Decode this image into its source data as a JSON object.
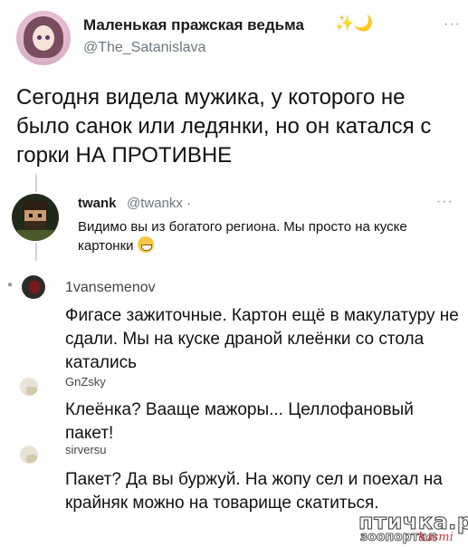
{
  "tweet": {
    "author_name": "Маленькая пражская ведьма",
    "author_emoji": "✨🌙",
    "author_handle": "@The_Satanislava",
    "more": "···",
    "text": "Сегодня видела мужика, у которого не было санок или ледянки, но он катался с горки НА ПРОТИВНЕ"
  },
  "reply": {
    "name": "twank",
    "handle": "@twankx ·",
    "more": "···",
    "text": "Видимо вы из богатого региона. Мы просто на куске картонки"
  },
  "comments": [
    {
      "name": "1vansemenov",
      "text": "Фигасе зажиточные. Картон ещё в макулатуру не сдали. Мы на куске драной клеёнки со стола катались"
    },
    {
      "name": "GnZsky",
      "text": "Клеёнка? Вааще мажоры...  Целлофановый пакет!"
    },
    {
      "name": "sirversu",
      "text": "Пакет? Да вы буржуй. На жопу сел и поехал на крайняк можно на товарище скатиться."
    }
  ],
  "watermark": {
    "line1": "птичка.ру",
    "line2": "зоопортал",
    "line3": "kasmi"
  }
}
